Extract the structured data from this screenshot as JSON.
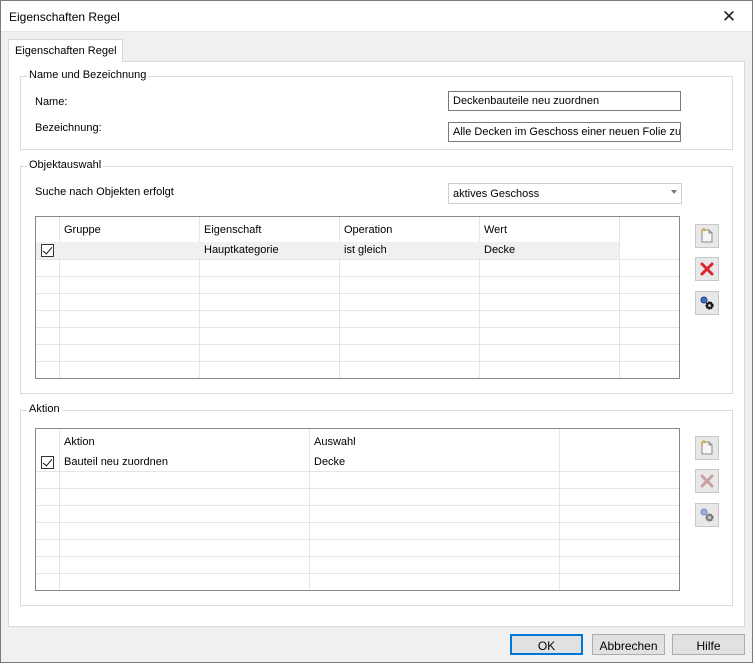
{
  "window": {
    "title": "Eigenschaften Regel",
    "close_icon": "close-icon"
  },
  "tab": {
    "label": "Eigenschaften Regel"
  },
  "name_group": {
    "legend": "Name und Bezeichnung",
    "name_label": "Name:",
    "name_value": "Deckenbauteile neu zuordnen",
    "desc_label": "Bezeichnung:",
    "desc_value": "Alle Decken im Geschoss einer neuen Folie zuor"
  },
  "object_group": {
    "legend": "Objektauswahl",
    "search_label": "Suche nach Objekten erfolgt",
    "search_value": "aktives Geschoss",
    "columns": [
      "Gruppe",
      "Eigenschaft",
      "Operation",
      "Wert"
    ],
    "rows": [
      {
        "checked": true,
        "gruppe": "",
        "eigenschaft": "Hauptkategorie",
        "operation": "ist gleich",
        "wert": "Decke"
      }
    ]
  },
  "action_group": {
    "legend": "Aktion",
    "columns": [
      "Aktion",
      "Auswahl"
    ],
    "rows": [
      {
        "checked": true,
        "aktion": "Bauteil neu zuordnen",
        "auswahl": "Decke"
      }
    ]
  },
  "buttons": {
    "ok": "OK",
    "cancel": "Abbrechen",
    "help": "Hilfe"
  },
  "colors": {
    "delete_red": "#d9262c",
    "delete_disabled": "#c9a0a0",
    "selection_border": "#0078d7"
  }
}
